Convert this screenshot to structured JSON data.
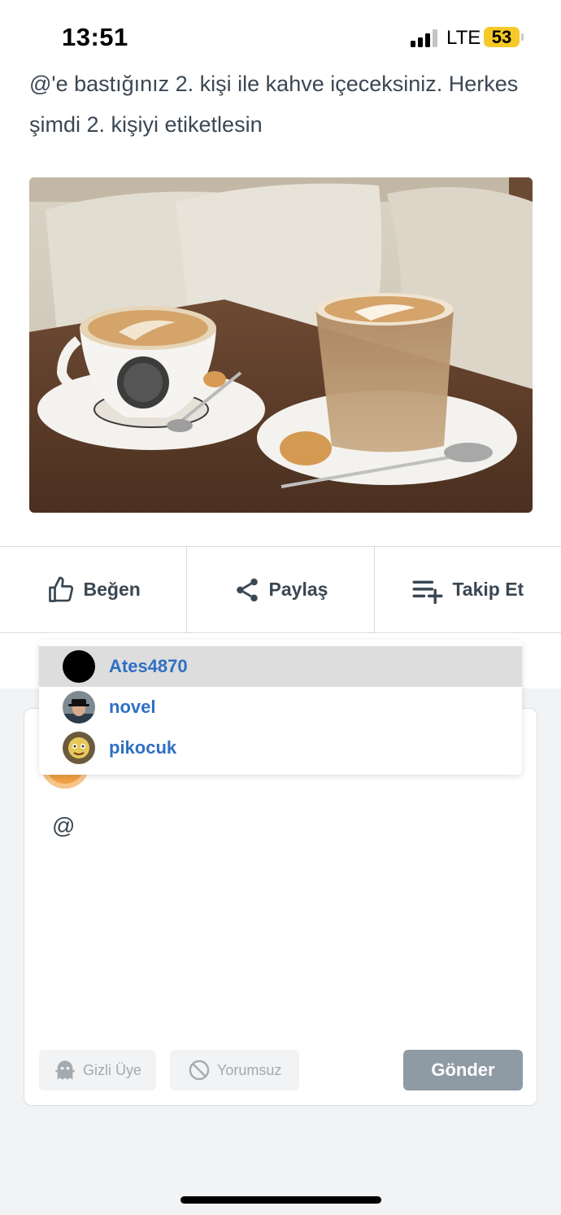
{
  "status_bar": {
    "time": "13:51",
    "network": "LTE",
    "battery": "53"
  },
  "post": {
    "text": "@'e bastığınız 2. kişi ile kahve içeceksiniz. Herkes şimdi 2. kişiyi etiketlesin"
  },
  "actions": {
    "like_label": "Beğen",
    "share_label": "Paylaş",
    "follow_label": "Takip Et"
  },
  "mention_suggestions": [
    {
      "username": "Ates4870",
      "avatar": "black-circle-avatar"
    },
    {
      "username": "novel",
      "avatar": "man-with-hat-avatar"
    },
    {
      "username": "pikocuk",
      "avatar": "cartoon-avatar"
    }
  ],
  "comment": {
    "input_value": "@",
    "anonymous_label": "Gizli Üye",
    "no_comment_label": "Yorumsuz",
    "send_label": "Gönder"
  },
  "colors": {
    "mention_name": "#2f6fc4",
    "send_button": "#8e9aa4",
    "battery": "#f6c928"
  }
}
